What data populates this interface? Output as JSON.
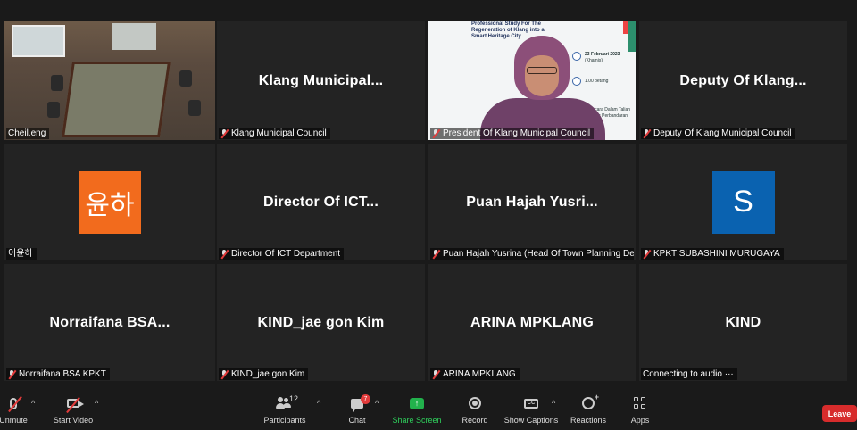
{
  "tiles": [
    {
      "center_name": "",
      "label": "Cheil.eng",
      "muted": false
    },
    {
      "center_name": "Klang  Municipal...",
      "label": "Klang Municipal Council",
      "muted": true
    },
    {
      "center_name": "",
      "label": "President Of Klang Municipal Council",
      "muted": true
    },
    {
      "center_name": "Deputy Of Klang...",
      "label": "Deputy Of Klang Municipal Council",
      "muted": true
    },
    {
      "center_name": "",
      "label": "이윤하",
      "avatar": "윤하",
      "avatar_color": "#f26b1d",
      "muted": false
    },
    {
      "center_name": "Director Of ICT...",
      "label": "Director Of ICT Department",
      "muted": true
    },
    {
      "center_name": "Puan Hajah Yusri...",
      "label": "Puan Hajah Yusrina (Head Of Town Planning Dea...",
      "muted": true
    },
    {
      "center_name": "",
      "label": "KPKT SUBASHINI MURUGAYA",
      "avatar": "S",
      "avatar_color": "#0a62b0",
      "muted": true
    },
    {
      "center_name": "Norraifana  BSA...",
      "label": "Norraifana BSA KPKT",
      "muted": true
    },
    {
      "center_name": "KIND_jae gon Kim",
      "label": "KIND_jae gon Kim",
      "muted": true
    },
    {
      "center_name": "ARINA MPKLANG",
      "label": "ARINA MPKLANG",
      "muted": true
    },
    {
      "center_name": "KIND",
      "label": "Connecting to audio ···",
      "muted": false
    }
  ],
  "slide": {
    "title_lines": [
      "Professional Study For The",
      "Regeneration of Klang into a",
      "Smart Heritage City"
    ],
    "date": "23 Februari 2023",
    "date_sub": "(Khamis)",
    "time": "1.00 petang",
    "venue": "Secara Dalam Talian",
    "venue_sub": "Majlis Perbandaran Klang"
  },
  "toolbar": {
    "unmute": "Unmute",
    "start_video": "Start Video",
    "participants": "Participants",
    "participants_count": "12",
    "chat": "Chat",
    "chat_badge": "7",
    "share_screen": "Share Screen",
    "record": "Record",
    "show_captions": "Show Captions",
    "captions_icon_text": "CC",
    "reactions": "Reactions",
    "apps": "Apps",
    "leave": "Leave",
    "caret": "^"
  },
  "colors": {
    "active_speaker": "#e7e36b",
    "leave": "#d72c2c",
    "share": "#22b14c",
    "muted": "#e23b3b"
  }
}
